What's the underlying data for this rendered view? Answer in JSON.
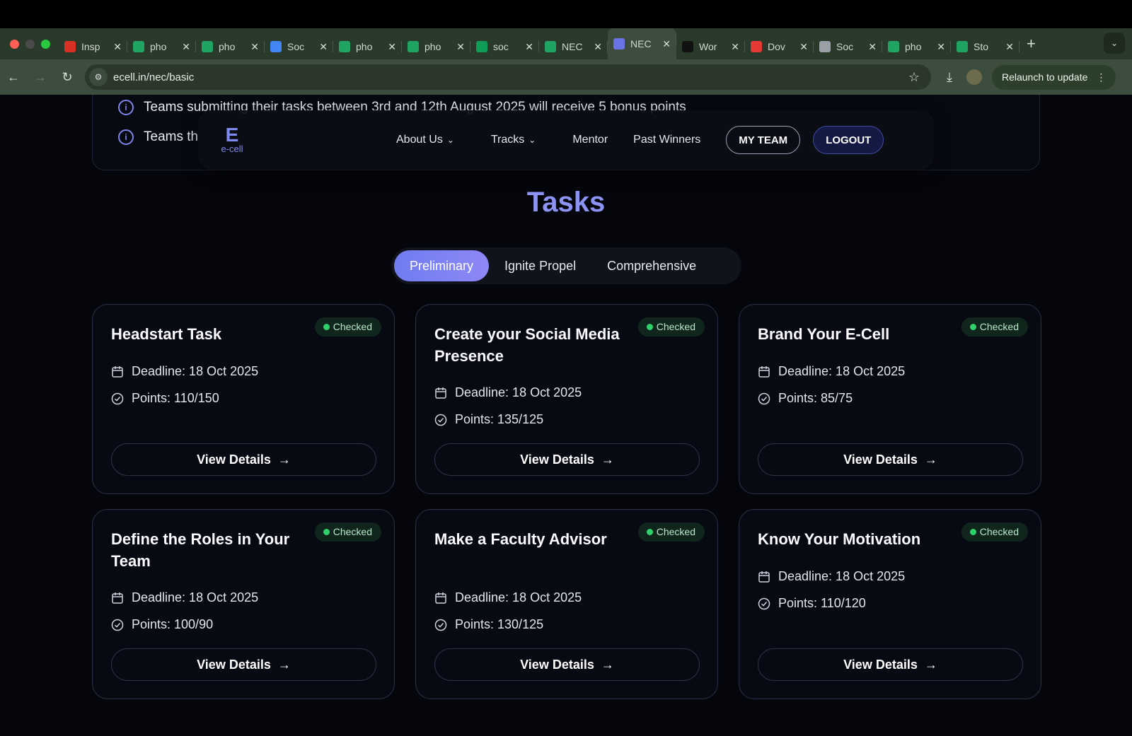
{
  "browser": {
    "tabs": [
      {
        "label": "Insp",
        "color": "#d93025"
      },
      {
        "label": "pho",
        "color": "#1fa463"
      },
      {
        "label": "pho",
        "color": "#1fa463"
      },
      {
        "label": "Soc",
        "color": "#4285f4"
      },
      {
        "label": "pho",
        "color": "#1fa463"
      },
      {
        "label": "pho",
        "color": "#1fa463"
      },
      {
        "label": "soc",
        "color": "#0f9d58"
      },
      {
        "label": "NEC",
        "color": "#1fa463"
      },
      {
        "label": "NEC",
        "color": "#6a74e6"
      },
      {
        "label": "Wor",
        "color": "#111111"
      },
      {
        "label": "Dov",
        "color": "#e53935"
      },
      {
        "label": "Soc",
        "color": "#9aa0a6"
      },
      {
        "label": "pho",
        "color": "#1fa463"
      },
      {
        "label": "Sto",
        "color": "#1fa463"
      }
    ],
    "active_tab": 8,
    "url": "ecell.in/nec/basic",
    "relaunch_label": "Relaunch to update"
  },
  "notices": [
    "Teams submitting their tasks between 3rd and 12th August 2025 will receive 5 bonus points",
    "Teams th"
  ],
  "nav": {
    "logo_big": "E",
    "logo_small": "e-cell",
    "links": [
      {
        "label": "About Us",
        "has_dropdown": true
      },
      {
        "label": "Tracks",
        "has_dropdown": true
      },
      {
        "label": "Mentor",
        "has_dropdown": false
      },
      {
        "label": "Past Winners",
        "has_dropdown": false
      }
    ],
    "my_team": "MY TEAM",
    "logout": "LOGOUT"
  },
  "tasks_title": "Tasks",
  "segments": [
    "Preliminary",
    "Ignite Propel",
    "Comprehensive"
  ],
  "active_segment": 0,
  "cards": [
    {
      "title": "Headstart Task",
      "status": "Checked",
      "deadline": "Deadline: 18 Oct 2025",
      "points": "Points: 110/150"
    },
    {
      "title": "Create your Social Media Presence",
      "status": "Checked",
      "deadline": "Deadline: 18 Oct 2025",
      "points": "Points: 135/125"
    },
    {
      "title": "Brand Your E-Cell",
      "status": "Checked",
      "deadline": "Deadline: 18 Oct 2025",
      "points": "Points: 85/75"
    },
    {
      "title": "Define the Roles in Your Team",
      "status": "Checked",
      "deadline": "Deadline: 18 Oct 2025",
      "points": "Points: 100/90"
    },
    {
      "title": "Make a Faculty Advisor",
      "status": "Checked",
      "deadline": "Deadline: 18 Oct 2025",
      "points": "Points: 130/125"
    },
    {
      "title": "Know Your Motivation",
      "status": "Checked",
      "deadline": "Deadline: 18 Oct 2025",
      "points": "Points: 110/120"
    }
  ],
  "view_details_label": "View Details",
  "colors": {
    "accent": "#8d93f3",
    "checked": "#2fd16a"
  }
}
